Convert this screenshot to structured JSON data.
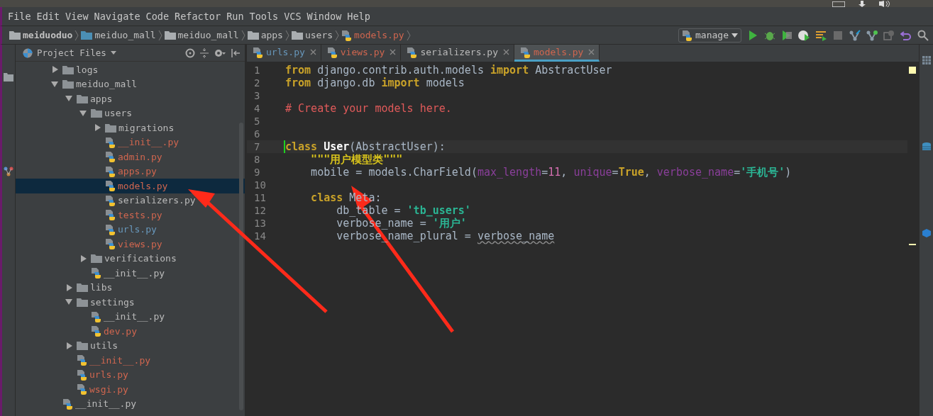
{
  "menu": [
    "File",
    "Edit",
    "View",
    "Navigate",
    "Code",
    "Refactor",
    "Run",
    "Tools",
    "VCS",
    "Window",
    "Help"
  ],
  "breadcrumb": [
    {
      "label": "meiduoduo",
      "kind": "root"
    },
    {
      "label": "meiduo_mall",
      "kind": "module"
    },
    {
      "label": "meiduo_mall",
      "kind": "package"
    },
    {
      "label": "apps",
      "kind": "package"
    },
    {
      "label": "users",
      "kind": "package"
    },
    {
      "label": "models.py",
      "kind": "file",
      "color": "#d0664f"
    }
  ],
  "run_config": "manage",
  "project_panel": {
    "title": "Project Files",
    "tree": [
      {
        "label": "logs",
        "kind": "folder",
        "expanded": false,
        "selected": false
      },
      {
        "label": "meiduo_mall",
        "kind": "folder",
        "expanded": true,
        "selected": false,
        "children": [
          {
            "label": "apps",
            "kind": "folder",
            "expanded": true,
            "selected": false,
            "children": [
              {
                "label": "users",
                "kind": "folder",
                "expanded": true,
                "selected": false,
                "children": [
                  {
                    "label": "migrations",
                    "kind": "folder",
                    "expanded": false,
                    "selected": false
                  },
                  {
                    "label": "__init__.py",
                    "kind": "file",
                    "color": "#d0664f",
                    "selected": false
                  },
                  {
                    "label": "admin.py",
                    "kind": "file",
                    "color": "#d0664f",
                    "selected": false
                  },
                  {
                    "label": "apps.py",
                    "kind": "file",
                    "color": "#d0664f",
                    "selected": false
                  },
                  {
                    "label": "models.py",
                    "kind": "file",
                    "color": "#d0664f",
                    "selected": true
                  },
                  {
                    "label": "serializers.py",
                    "kind": "file",
                    "color": "#bbbbbb",
                    "selected": false
                  },
                  {
                    "label": "tests.py",
                    "kind": "file",
                    "color": "#d0664f",
                    "selected": false
                  },
                  {
                    "label": "urls.py",
                    "kind": "file",
                    "color": "#6897bb",
                    "selected": false
                  },
                  {
                    "label": "views.py",
                    "kind": "file",
                    "color": "#d0664f",
                    "selected": false
                  }
                ]
              },
              {
                "label": "verifications",
                "kind": "folder",
                "expanded": false,
                "selected": false
              },
              {
                "label": "__init__.py",
                "kind": "file",
                "color": "#bbbbbb",
                "selected": false
              }
            ]
          },
          {
            "label": "libs",
            "kind": "folder",
            "expanded": false,
            "selected": false
          },
          {
            "label": "settings",
            "kind": "folder",
            "expanded": true,
            "selected": false,
            "children": [
              {
                "label": "__init__.py",
                "kind": "file",
                "color": "#bbbbbb",
                "selected": false
              },
              {
                "label": "dev.py",
                "kind": "file",
                "color": "#d0664f",
                "selected": false
              }
            ]
          },
          {
            "label": "utils",
            "kind": "folder",
            "expanded": false,
            "selected": false
          },
          {
            "label": "__init__.py",
            "kind": "file",
            "color": "#d0664f",
            "selected": false
          },
          {
            "label": "urls.py",
            "kind": "file",
            "color": "#d0664f",
            "selected": false
          },
          {
            "label": "wsgi.py",
            "kind": "file",
            "color": "#d0664f",
            "selected": false
          }
        ]
      },
      {
        "label": "__init__.py",
        "kind": "file",
        "color": "#bbbbbb",
        "selected": false
      }
    ]
  },
  "tabs": [
    {
      "label": "urls.py",
      "color": "#6897bb",
      "selected": false
    },
    {
      "label": "views.py",
      "color": "#d0664f",
      "selected": false
    },
    {
      "label": "serializers.py",
      "color": "#bbbbbb",
      "selected": false
    },
    {
      "label": "models.py",
      "color": "#d0664f",
      "selected": true
    }
  ],
  "editor": {
    "lines": [
      {
        "number": "1",
        "current": false,
        "tokens": [
          {
            "kind": "kw",
            "text": "from"
          },
          {
            "kind": "plain",
            "text": " django.contrib.auth.models "
          },
          {
            "kind": "kw",
            "text": "import"
          },
          {
            "kind": "plain",
            "text": " AbstractUser"
          }
        ]
      },
      {
        "number": "2",
        "current": false,
        "tokens": [
          {
            "kind": "kw",
            "text": "from"
          },
          {
            "kind": "plain",
            "text": " django.db "
          },
          {
            "kind": "kw",
            "text": "import"
          },
          {
            "kind": "plain",
            "text": " models"
          }
        ]
      },
      {
        "number": "3",
        "current": false
      },
      {
        "number": "4",
        "current": false,
        "tokens": [
          {
            "kind": "comment",
            "text": "# Create your models here."
          }
        ]
      },
      {
        "number": "5",
        "current": false
      },
      {
        "number": "6",
        "current": false
      },
      {
        "number": "7",
        "current": true,
        "tokens": [
          {
            "kind": "kw",
            "text": "class"
          },
          {
            "kind": "name",
            "text": " User"
          },
          {
            "kind": "plain",
            "text": "(AbstractUser):"
          }
        ]
      },
      {
        "number": "8",
        "current": false,
        "tokens": [
          {
            "kind": "doc",
            "text": "    \"\"\"用户模型类\"\"\""
          }
        ]
      },
      {
        "number": "9",
        "current": false,
        "tokens": [
          {
            "kind": "plain",
            "text": "    mobile = models.CharField("
          },
          {
            "kind": "param",
            "text": "max_length"
          },
          {
            "kind": "plain",
            "text": "="
          },
          {
            "kind": "number",
            "text": "11"
          },
          {
            "kind": "plain",
            "text": ", "
          },
          {
            "kind": "param",
            "text": "unique"
          },
          {
            "kind": "plain",
            "text": "="
          },
          {
            "kind": "kw",
            "text": "True"
          },
          {
            "kind": "plain",
            "text": ", "
          },
          {
            "kind": "param",
            "text": "verbose_name"
          },
          {
            "kind": "plain",
            "text": "="
          },
          {
            "kind": "string",
            "text": "'手机号'"
          },
          {
            "kind": "plain",
            "text": ")"
          }
        ]
      },
      {
        "number": "10",
        "current": false
      },
      {
        "number": "11",
        "current": false,
        "tokens": [
          {
            "kind": "kw",
            "text": "    class"
          },
          {
            "kind": "plain",
            "text": " Meta:"
          }
        ]
      },
      {
        "number": "12",
        "current": false,
        "tokens": [
          {
            "kind": "plain",
            "text": "        db_table = "
          },
          {
            "kind": "string",
            "text": "'tb_users'"
          }
        ]
      },
      {
        "number": "13",
        "current": false,
        "tokens": [
          {
            "kind": "plain",
            "text": "        verbose_name = "
          },
          {
            "kind": "string",
            "text": "'用户'"
          }
        ]
      },
      {
        "number": "14",
        "current": false,
        "tokens": [
          {
            "kind": "plain",
            "text": "        verbose_name_plural = "
          },
          {
            "kind": "warn",
            "text": "verbose_name"
          }
        ]
      }
    ]
  }
}
